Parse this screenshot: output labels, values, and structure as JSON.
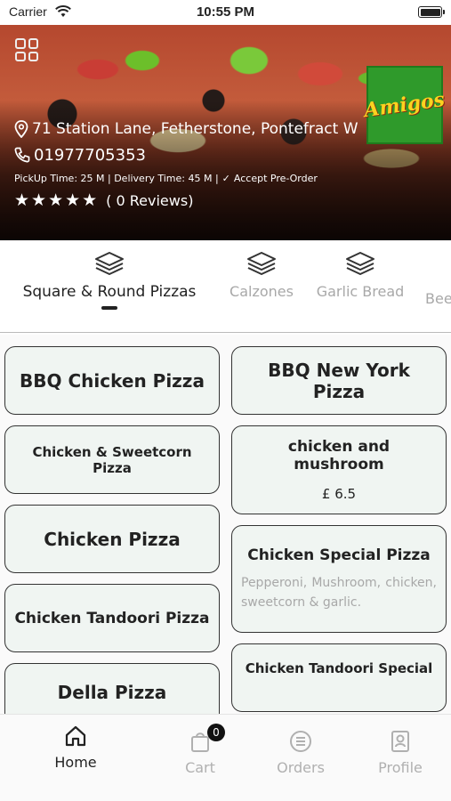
{
  "status_bar": {
    "carrier": "Carrier",
    "time": "10:55 PM"
  },
  "restaurant": {
    "logo_text": "Amigos",
    "address": "71 Station Lane, Fetherstone, Pontefract W",
    "phone": "01977705353",
    "times": "PickUp Time: 25 M | Delivery Time: 45 M |",
    "preorder": "Accept Pre-Order",
    "stars": "★★★★★",
    "reviews": "( 0 Reviews)"
  },
  "categories": [
    {
      "label": "Square & Round Pizzas",
      "active": true
    },
    {
      "label": "Calzones"
    },
    {
      "label": "Garlic Bread"
    },
    {
      "label": "Bee"
    }
  ],
  "menu_items": [
    {
      "name": "BBQ Chicken Pizza"
    },
    {
      "name": "BBQ New York Pizza"
    },
    {
      "name": "Chicken & Sweetcorn Pizza"
    },
    {
      "name": "chicken and mushroom",
      "price": "£ 6.5"
    },
    {
      "name": "Chicken Pizza"
    },
    {
      "name": "Chicken Special Pizza",
      "desc": "Pepperoni, Mushroom, chicken, sweetcorn & garlic."
    },
    {
      "name": "Chicken Tandoori Pizza"
    },
    {
      "name": "Chicken Tandoori Special"
    },
    {
      "name": "Della Pizza"
    }
  ],
  "bottom_nav": {
    "home": "Home",
    "cart": "Cart",
    "cart_count": "0",
    "orders": "Orders",
    "profile": "Profile"
  }
}
